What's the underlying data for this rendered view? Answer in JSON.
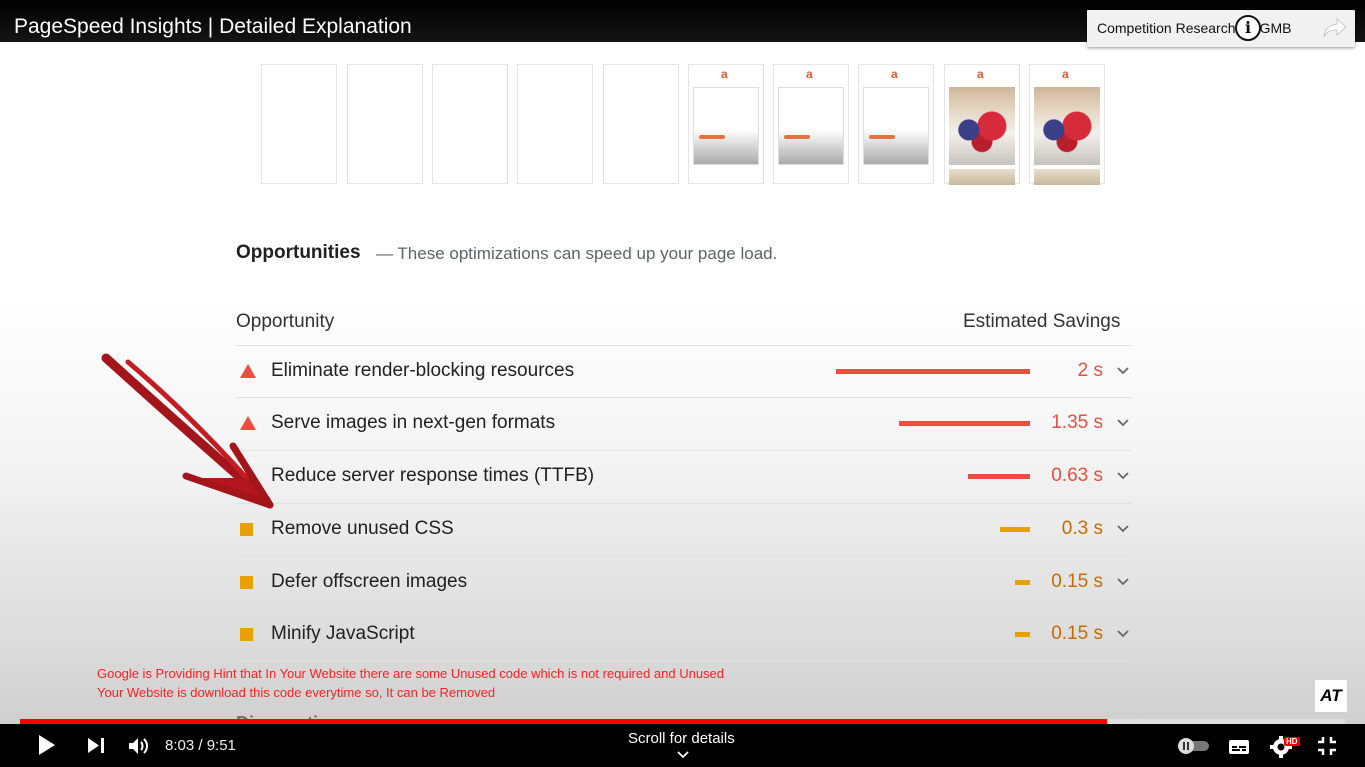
{
  "video": {
    "title": "PageSpeed Insights | Detailed Explanation",
    "card_teaser": "Competition Research for GMB"
  },
  "filmstrip": {
    "frames": [
      "blank",
      "blank",
      "blank",
      "blank",
      "blank",
      "loading",
      "loading",
      "loading",
      "image",
      "image"
    ],
    "logo_glyph": "a"
  },
  "opportunities": {
    "heading": "Opportunities",
    "description": "— These optimizations can speed up your page load.",
    "col_opportunity": "Opportunity",
    "col_savings": "Estimated Savings",
    "items": [
      {
        "label": "Eliminate render-blocking resources",
        "value": "2 s",
        "severity": "high",
        "color": "#eb4d3f"
      },
      {
        "label": "Serve images in next-gen formats",
        "value": "1.35 s",
        "severity": "high",
        "color": "#eb4d3f"
      },
      {
        "label": "Reduce server response times (TTFB)",
        "value": "0.63 s",
        "severity": "high",
        "color": "#eb4d3f"
      },
      {
        "label": "Remove unused CSS",
        "value": "0.3 s",
        "severity": "medium",
        "color": "#c96b00"
      },
      {
        "label": "Defer offscreen images",
        "value": "0.15 s",
        "severity": "medium",
        "color": "#c96b00"
      },
      {
        "label": "Minify JavaScript",
        "value": "0.15 s",
        "severity": "medium",
        "color": "#c96b00"
      }
    ],
    "next_heading": "Diagnostics"
  },
  "annotation": {
    "line1": "Google is Providing Hint that In Your Website there are some Unused code which is not required and Unused",
    "line2": "Your Website is download this code everytime so, It can be Removed"
  },
  "watermark": "AT",
  "player": {
    "time": "8:03 / 9:51",
    "progress": 0.82,
    "scroll_hint": "Scroll for details",
    "quality_badge": "HD"
  },
  "colors": {
    "high": "#eb4d3f",
    "medium": "#e8a100",
    "progress": "#ff0000",
    "annotation": "#ff2020"
  }
}
